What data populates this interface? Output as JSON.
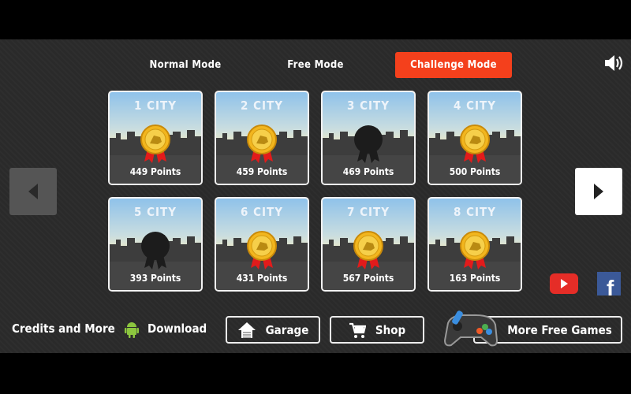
{
  "tabs": [
    {
      "label": "Normal Mode",
      "active": false
    },
    {
      "label": "Free Mode",
      "active": false
    },
    {
      "label": "Challenge Mode",
      "active": true
    }
  ],
  "accent": "#f4401c",
  "levels": [
    {
      "name": "1 CITY",
      "points": "449 Points",
      "medal": "gold"
    },
    {
      "name": "2 CITY",
      "points": "459 Points",
      "medal": "gold"
    },
    {
      "name": "3 CITY",
      "points": "469 Points",
      "medal": "locked"
    },
    {
      "name": "4 CITY",
      "points": "500 Points",
      "medal": "gold"
    },
    {
      "name": "5 CITY",
      "points": "393 Points",
      "medal": "locked"
    },
    {
      "name": "6 CITY",
      "points": "431 Points",
      "medal": "gold"
    },
    {
      "name": "7 CITY",
      "points": "567 Points",
      "medal": "gold"
    },
    {
      "name": "8 CITY",
      "points": "163 Points",
      "medal": "gold"
    }
  ],
  "footer": {
    "credits": "Credits and More",
    "download": "Download",
    "garage": "Garage",
    "shop": "Shop",
    "more_games": "More Free Games"
  },
  "icons": {
    "sound": "speaker-icon",
    "youtube": "youtube-icon",
    "facebook": "facebook-icon",
    "android": "android-icon",
    "gamepad": "gamepad-icon"
  }
}
